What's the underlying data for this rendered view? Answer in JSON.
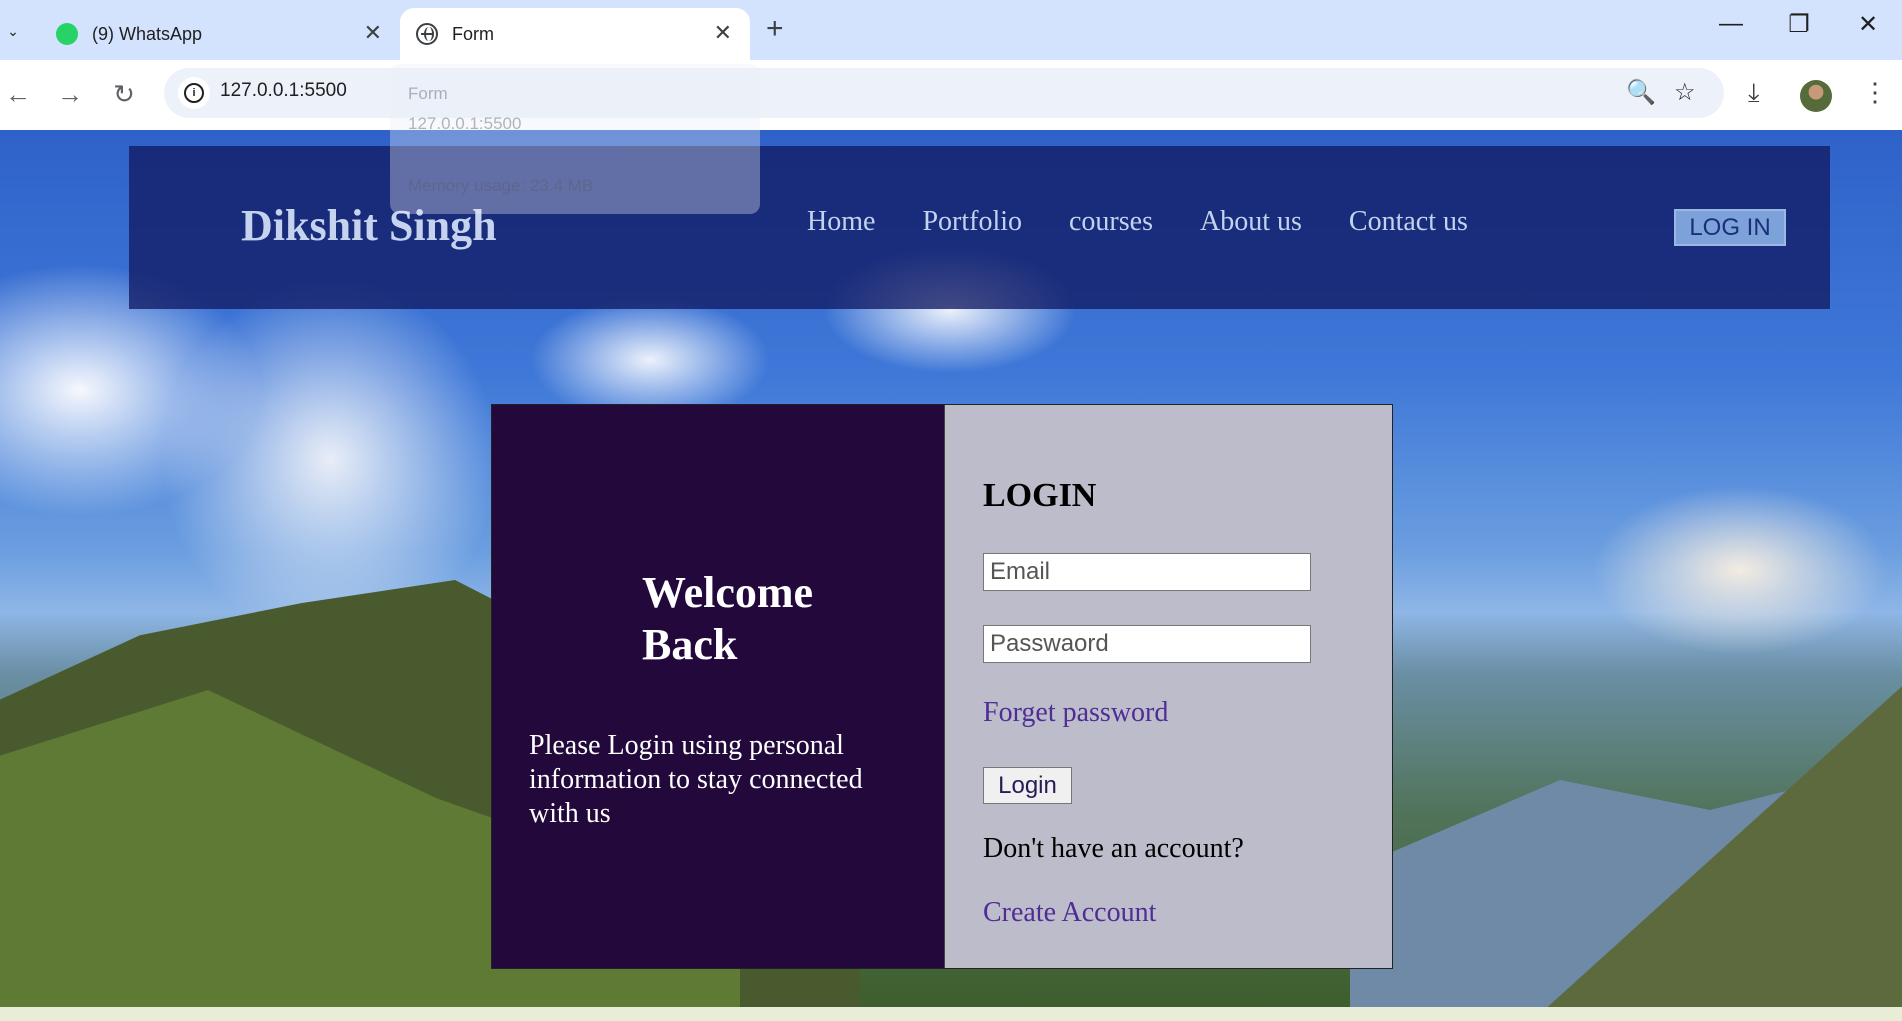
{
  "browser": {
    "tabs": [
      {
        "title": "(9) WhatsApp",
        "active": false
      },
      {
        "title": "Form",
        "active": true
      }
    ],
    "url": "127.0.0.1:5500",
    "tab_hover_card": {
      "title": "Form",
      "url": "127.0.0.1:5500",
      "memory": "Memory usage: 23.4 MB"
    }
  },
  "icons": {
    "close": "✕",
    "new_tab": "+",
    "minimize": "—",
    "restore": "❐",
    "back": "←",
    "forward": "→",
    "reload": "↻",
    "zoom": "🔍",
    "bookmark": "☆",
    "download": "⤓",
    "menu": "⋮",
    "tab_list": "⌄"
  },
  "site": {
    "brand": "Dikshit Singh",
    "nav": [
      "Home",
      "Portfolio",
      "courses",
      "About us",
      "Contact us"
    ],
    "login_button": "LOG IN"
  },
  "card": {
    "welcome": "Welcome Back",
    "lead": "Please Login using personal information to stay connected with us",
    "form": {
      "heading": "LOGIN",
      "email_placeholder": "Email",
      "password_placeholder": "Passwaord",
      "forgot": "Forget password",
      "submit": "Login",
      "no_account": "Don't have an account?",
      "create": "Create Account"
    }
  },
  "colors": {
    "navbar": "#121b64",
    "card_left": "#22083b",
    "card_right": "#bdbccb",
    "link": "#4f2d95"
  }
}
